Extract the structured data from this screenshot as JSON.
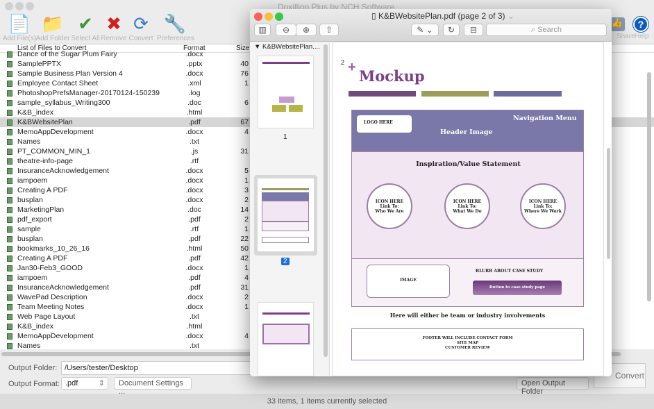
{
  "app": {
    "title": "Doxillion Plus by NCH Software"
  },
  "toolbar": [
    {
      "label": "Add File(s)",
      "icon": "add-file-icon"
    },
    {
      "label": "Add Folder",
      "icon": "add-folder-icon"
    },
    {
      "label": "Select All",
      "icon": "select-all-icon"
    },
    {
      "label": "Remove",
      "icon": "remove-icon"
    },
    {
      "label": "Convert",
      "icon": "convert-icon"
    },
    {
      "label": "Preferences",
      "icon": "preferences-icon"
    }
  ],
  "toolbar_right": {
    "share": "Share",
    "help": "Help"
  },
  "list": {
    "headers": {
      "name": "List of Files to Convert",
      "format": "Format",
      "size": "Size"
    },
    "rows": [
      [
        "Dance of the Sugar Plum Fairy",
        ".docx",
        ""
      ],
      [
        "SamplePPTX",
        ".pptx",
        "40"
      ],
      [
        "Sample Business Plan Version 4",
        ".docx",
        "76"
      ],
      [
        "Employee Contact Sheet",
        ".xml",
        "1"
      ],
      [
        "PhotoshopPrefsManager-20170124-150239",
        ".log",
        ""
      ],
      [
        "sample_syllabus_Writing300",
        ".doc",
        "6"
      ],
      [
        "K&B_index",
        ".html",
        ""
      ],
      [
        "K&BWebsitePlan",
        ".pdf",
        "67"
      ],
      [
        "MemoAppDevelopment",
        ".docx",
        "4"
      ],
      [
        "Names",
        ".txt",
        ""
      ],
      [
        "PT_COMMON_MIN_1",
        ".js",
        "31"
      ],
      [
        "theatre-info-page",
        ".rtf",
        ""
      ],
      [
        "InsuranceAcknowledgement",
        ".docx",
        "5"
      ],
      [
        "iampoem",
        ".docx",
        "1"
      ],
      [
        "Creating A PDF",
        ".docx",
        "3"
      ],
      [
        "busplan",
        ".docx",
        "2"
      ],
      [
        "MarketingPlan",
        ".doc",
        "14"
      ],
      [
        "pdf_export",
        ".pdf",
        "2"
      ],
      [
        "sample",
        ".rtf",
        "1"
      ],
      [
        "busplan",
        ".pdf",
        "22"
      ],
      [
        "bookmarks_10_26_16",
        ".html",
        "50"
      ],
      [
        "Creating A PDF",
        ".pdf",
        "42"
      ],
      [
        "Jan30-Feb3_GOOD",
        ".docx",
        "1"
      ],
      [
        "iampoem",
        ".pdf",
        "4"
      ],
      [
        "InsuranceAcknowledgement",
        ".pdf",
        "31"
      ],
      [
        "WavePad Description",
        ".docx",
        "2"
      ],
      [
        "Team Meeting Notes",
        ".docx",
        "1"
      ],
      [
        "Web Page Layout",
        ".txt",
        ""
      ],
      [
        "K&B_index",
        ".html",
        ""
      ],
      [
        "MemoAppDevelopment",
        ".docx",
        "4"
      ],
      [
        "Names",
        ".txt",
        ""
      ]
    ],
    "selected_index": 7
  },
  "bottom": {
    "output_folder_label": "Output Folder:",
    "output_folder": "/Users/tester/Desktop",
    "output_format_label": "Output Format:",
    "output_format": ".pdf",
    "doc_settings": "Document Settings ...",
    "open_folder": "Open Output Folder",
    "convert": "Convert"
  },
  "status": "33 items, 1 items currently selected",
  "preview": {
    "title": "K&BWebsitePlan.pdf (page 2 of 3)",
    "search_placeholder": "Search",
    "sidebar_title": "K&BWebsitePlan....",
    "pages": [
      "1",
      "2"
    ],
    "current_page": "2",
    "page": {
      "number": "2",
      "heading": "Mockup",
      "logo": "LOGO HERE",
      "nav": "Navigation Menu",
      "header_image": "Header Image",
      "statement": "Inspiration/Value Statement",
      "circles": [
        [
          "ICON HERE",
          "Link To:",
          "Who We Are"
        ],
        [
          "ICON HERE",
          "Link To:",
          "What We Do"
        ],
        [
          "ICON HERE",
          "Link To:",
          "Where We Work"
        ]
      ],
      "image": "IMAGE",
      "blurb": "BLURB ABOUT CASE STUDY",
      "case_button": "Button to case study page",
      "involvements": "Here will either be team or industry involvements",
      "footer": [
        "FOOTER WILL INCLUDE CONTACT FORM",
        "SITE MAP",
        "CUSTOMER REVIEW"
      ]
    },
    "colors": {
      "purple": "#7b3f8a",
      "header": "#7a78a8",
      "olive": "#9a9e5a",
      "slate": "#6c6c9e"
    }
  }
}
